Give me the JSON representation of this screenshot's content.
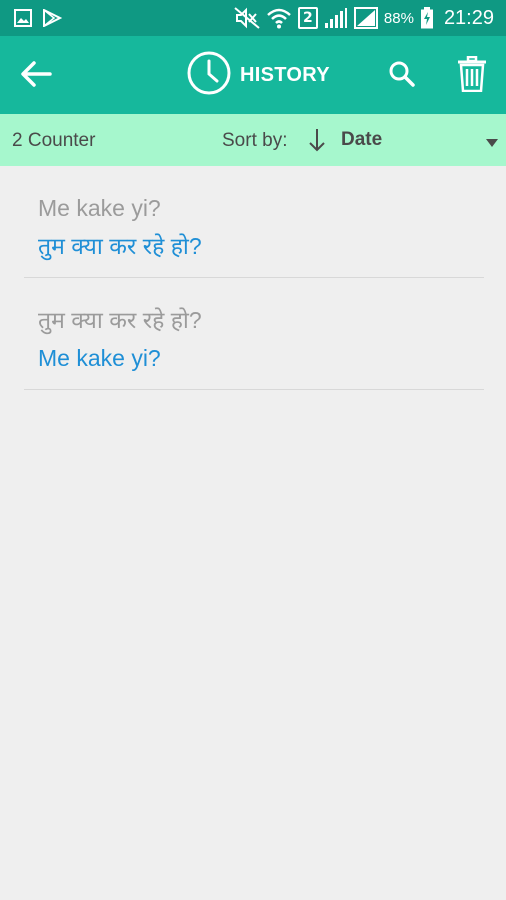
{
  "status_bar": {
    "sim_slot": "2",
    "battery": "88%",
    "time": "21:29",
    "icons": [
      "gallery-icon",
      "play-store-icon",
      "mute-icon",
      "wifi-icon",
      "sim-icon",
      "signal-icon",
      "signal-icon",
      "battery-charging-icon"
    ]
  },
  "app_bar": {
    "title": "HISTORY",
    "icons": [
      "back-arrow-icon",
      "clock-icon",
      "search-icon",
      "trash-icon"
    ]
  },
  "sort_bar": {
    "counter": "2 Counter",
    "sort_label": "Sort by:",
    "sort_value": "Date"
  },
  "history": [
    {
      "source": "Me kake yi?",
      "translation": "तुम क्या कर रहे हो?"
    },
    {
      "source": "तुम क्या कर रहे हो?",
      "translation": "Me kake yi?"
    }
  ],
  "colors": {
    "status_bar": "#0f9983",
    "app_bar": "#16b89c",
    "sort_bar": "#a6f7cd",
    "source_text": "#9b9b9b",
    "translation_text": "#1f8fd6",
    "background": "#efefef"
  }
}
